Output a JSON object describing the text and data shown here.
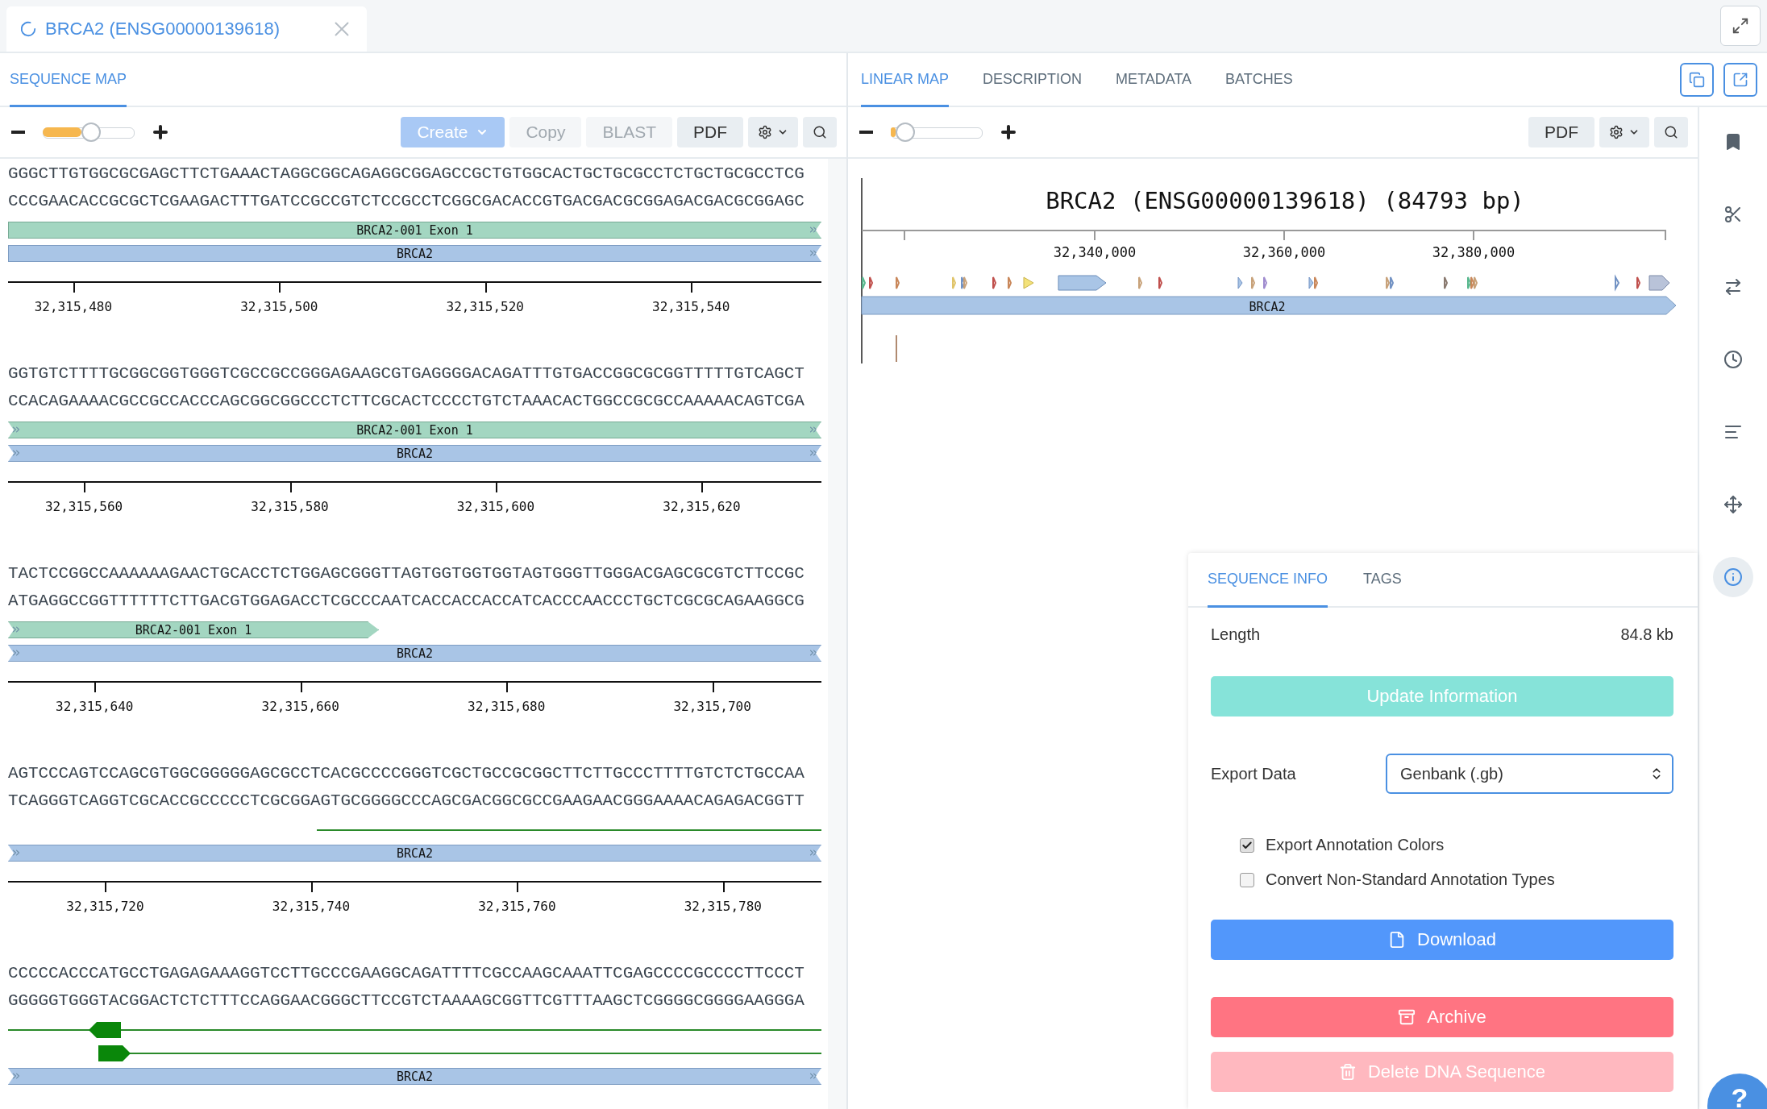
{
  "doc_tab": {
    "title": "BRCA2 (ENSG00000139618)"
  },
  "left_panel": {
    "tabs": [
      {
        "label": "SEQUENCE MAP",
        "selected": true
      }
    ],
    "zoom": {
      "level": 0.42
    },
    "buttons": [
      {
        "label": "Create",
        "kind": "primary",
        "disabled": true,
        "dropdown": true
      },
      {
        "label": "Copy",
        "kind": "plain",
        "disabled": true,
        "dropdown": false
      },
      {
        "label": "BLAST",
        "kind": "plain",
        "disabled": true,
        "dropdown": false
      },
      {
        "label": "PDF",
        "kind": "plain",
        "disabled": false,
        "dropdown": false
      }
    ],
    "rows": [
      {
        "top": "GGGCTTGTGGCGCGAGCTTCTGAAACTAGGCGGCAGAGGCGGAGCCGCTGTGGCACTGCTGCGCCTCTGCTGCGCCTCG",
        "bottom": "CCCGAACACCGCGCTCGAAGACTTTGATCCGCCGTCTCCGCCTCGGCGACACCGTGACGACGCGGAGACGACGCGGAGC",
        "features": [
          {
            "kind": "exon",
            "label": "BRCA2-001 Exon 1",
            "from_left": false,
            "to_right": true
          },
          {
            "kind": "gene",
            "label": "BRCA2",
            "from_left": false,
            "to_right": true
          }
        ],
        "ticks": [
          "32,315,480",
          "32,315,500",
          "32,315,520",
          "32,315,540"
        ]
      },
      {
        "top": "GGTGTCTTTTGCGGCGGTGGGTCGCCGCCGGGAGAAGCGTGAGGGGACAGATTTGTGACCGGCGCGGTTTTTGTCAGCT",
        "bottom": "CCACAGAAAACGCCGCCACCCAGCGGCGGCCCTCTTCGCACTCCCCTGTCTAAACACTGGCCGCGCCAAAAACAGTCGA",
        "features": [
          {
            "kind": "exon",
            "label": "BRCA2-001 Exon 1",
            "from_left": true,
            "to_right": true
          },
          {
            "kind": "gene",
            "label": "BRCA2",
            "from_left": true,
            "to_right": true
          }
        ],
        "ticks": [
          "32,315,560",
          "32,315,580",
          "32,315,600",
          "32,315,620"
        ]
      },
      {
        "top": "TACTCCGGCCAAAAAAGAACTGCACCTCTGGAGCGGGTTAGTGGTGGTGGTAGTGGGTTGGGACGAGCGCGTCTTCCGC",
        "bottom": "ATGAGGCCGGTTTTTTCTTGACGTGGAGACCTCGCCCAATCACCACCACCATCACCCAACCCTGCTCGCGCAGAAGGCG",
        "features": [
          {
            "kind": "exon",
            "label": "BRCA2-001 Exon 1",
            "from_left": true,
            "to_right": false
          },
          {
            "kind": "gene",
            "label": "BRCA2",
            "from_left": true,
            "to_right": true
          }
        ],
        "ticks": [
          "32,315,640",
          "32,315,660",
          "32,315,680",
          "32,315,700"
        ]
      },
      {
        "top": "AGTCCCAGTCCAGCGTGGCGGGGGAGCGCCTCACGCCCCGGGTCGCTGCCGCGGCTTCTTGCCCTTTTGTCTCTGCCAA",
        "bottom": "TCAGGGTCAGGTCGCACCGCCCCCTCGCGGAGTGCGGGGCCCAGCGACGGCGCCGAAGAACGGGAAAACAGAGACGGTT",
        "features": [
          {
            "kind": "line-start"
          },
          {
            "kind": "gene",
            "label": "BRCA2",
            "from_left": true,
            "to_right": true
          }
        ],
        "ticks": [
          "32,315,720",
          "32,315,740",
          "32,315,760",
          "32,315,780"
        ]
      },
      {
        "top": "CCCCCACCCATGCCTGAGAGAAAGGTCCTTGCCCGAAGGCAGATTTTCGCCAAGCAAATTCGAGCCCCGCCCCTTCCCT",
        "bottom": "GGGGGTGGGTACGGACTCTCTTTCCAGGAACGGGCTTCCGTCTAAAAGCGGTTCGTTTAAGCTCGGGGCGGGGAAGGGA",
        "features": [
          {
            "kind": "reverse-line"
          },
          {
            "kind": "forward-line"
          },
          {
            "kind": "gene",
            "label": "BRCA2",
            "from_left": true,
            "to_right": true
          }
        ]
      }
    ]
  },
  "right_panel": {
    "tabs": [
      {
        "label": "LINEAR MAP",
        "selected": true
      },
      {
        "label": "DESCRIPTION",
        "selected": false
      },
      {
        "label": "METADATA",
        "selected": false
      },
      {
        "label": "BATCHES",
        "selected": false
      }
    ],
    "zoom": {
      "level": 0.05
    },
    "buttons": [
      {
        "label": "PDF"
      }
    ],
    "linear_map": {
      "title": "BRCA2 (ENSG00000139618) (84793 bp)",
      "axis_labels": [
        "32,340,000",
        "32,360,000",
        "32,380,000"
      ],
      "gene_label": "BRCA2"
    },
    "sidebar": [
      {
        "kind": "bookmark",
        "selected": false
      },
      {
        "kind": "cut",
        "selected": false
      },
      {
        "kind": "swap",
        "selected": false
      },
      {
        "kind": "history",
        "selected": false
      },
      {
        "kind": "lines",
        "selected": false
      },
      {
        "kind": "move",
        "selected": false
      },
      {
        "kind": "info",
        "selected": true
      }
    ],
    "info_panel": {
      "tabs": [
        {
          "label": "SEQUENCE INFO",
          "selected": true
        },
        {
          "label": "TAGS",
          "selected": false
        }
      ],
      "length_label": "Length",
      "length_value": "84.8 kb",
      "update_button": "Update Information",
      "export_label": "Export Data",
      "export_value": "Genbank (.gb)",
      "options": [
        {
          "label": "Export Annotation Colors",
          "checked": true
        },
        {
          "label": "Convert Non-Standard Annotation Types",
          "checked": false
        }
      ],
      "actions": [
        {
          "kind": "download",
          "label": "Download",
          "disabled": false
        },
        {
          "kind": "archive",
          "label": "Archive",
          "disabled": false
        },
        {
          "kind": "delete",
          "label": "Delete DNA Sequence",
          "disabled": true
        }
      ]
    }
  },
  "help": "?"
}
